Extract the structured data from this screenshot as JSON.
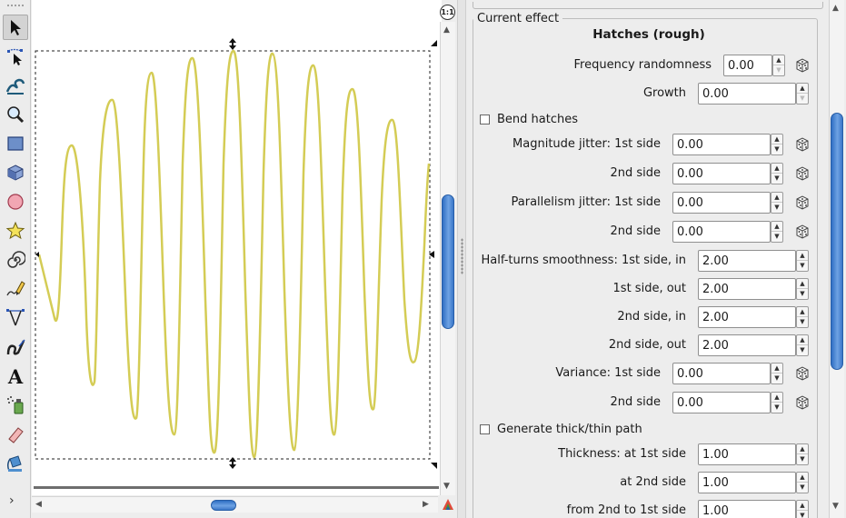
{
  "toolbox": {
    "tools": [
      {
        "name": "selector-tool-icon",
        "active": true
      },
      {
        "name": "node-tool-icon"
      },
      {
        "name": "tweak-tool-icon"
      },
      {
        "name": "zoom-tool-icon"
      },
      {
        "name": "rectangle-tool-icon"
      },
      {
        "name": "3d-box-tool-icon"
      },
      {
        "name": "ellipse-tool-icon"
      },
      {
        "name": "star-tool-icon"
      },
      {
        "name": "spiral-tool-icon"
      },
      {
        "name": "pencil-tool-icon"
      },
      {
        "name": "pen-tool-icon"
      },
      {
        "name": "calligraphy-tool-icon"
      },
      {
        "name": "text-tool-icon"
      },
      {
        "name": "spray-tool-icon"
      },
      {
        "name": "eraser-tool-icon"
      },
      {
        "name": "paint-bucket-tool-icon"
      }
    ],
    "text_tool_glyph": "A",
    "more_glyph": "›"
  },
  "canvas": {
    "stroke_color": "#d4cc55",
    "zoom_toggle_label": "1:1"
  },
  "dialog": {
    "frame_title": "Current effect",
    "effect_name": "Hatches (rough)",
    "params": [
      {
        "label": "Frequency randomness",
        "value": "0.00",
        "dice": true,
        "spin_disabled": "down"
      },
      {
        "label": "Growth",
        "value": "0.00",
        "dice": false,
        "spin_disabled": "down"
      },
      {
        "label": "Magnitude jitter: 1st side",
        "value": "0.00",
        "dice": true
      },
      {
        "label": "2nd side",
        "value": "0.00",
        "dice": true
      },
      {
        "label": "Parallelism jitter: 1st side",
        "value": "0.00",
        "dice": true
      },
      {
        "label": "2nd side",
        "value": "0.00",
        "dice": true
      },
      {
        "label": "Half-turns smoothness: 1st side, in",
        "value": "2.00",
        "dice": false
      },
      {
        "label": "1st side, out",
        "value": "2.00",
        "dice": false
      },
      {
        "label": "2nd side, in",
        "value": "2.00",
        "dice": false
      },
      {
        "label": "2nd side, out",
        "value": "2.00",
        "dice": false
      },
      {
        "label": "Variance: 1st side",
        "value": "0.00",
        "dice": true
      },
      {
        "label": "2nd side",
        "value": "0.00",
        "dice": true
      },
      {
        "label": "Thickness: at 1st side",
        "value": "1.00",
        "dice": false
      },
      {
        "label": "at 2nd side",
        "value": "1.00",
        "dice": false
      },
      {
        "label": "from 2nd to 1st side",
        "value": "1.00",
        "dice": false
      }
    ],
    "checkboxes": [
      {
        "label": "Bend hatches",
        "checked": false
      },
      {
        "label": "Generate thick/thin path",
        "checked": false
      }
    ]
  }
}
